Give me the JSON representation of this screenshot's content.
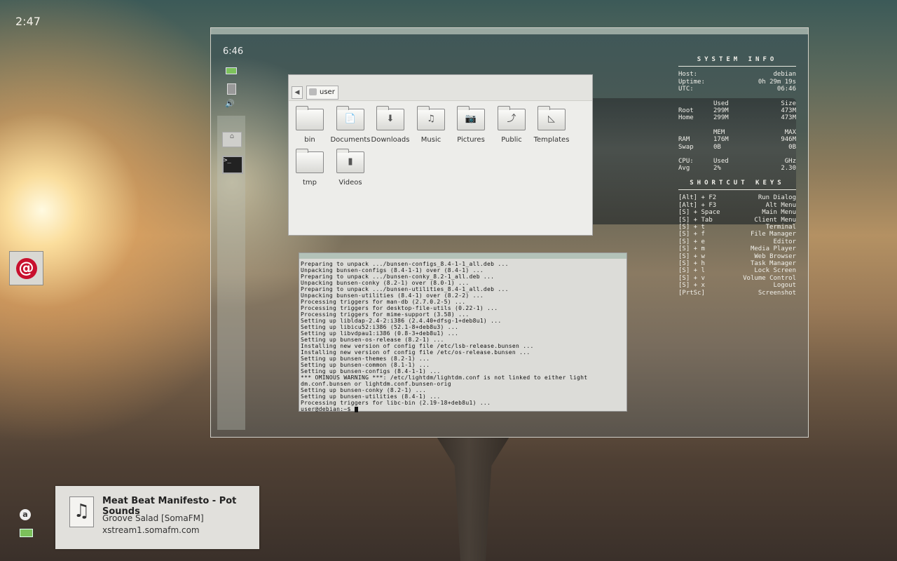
{
  "desktop": {
    "clock": "2:47",
    "launcher_icon": "debian-swirl-icon",
    "tray": {
      "icons": [
        "a-indicator-icon",
        "battery-icon"
      ],
      "a_label": "a"
    }
  },
  "notification": {
    "icon": "music-note-icon",
    "title": "Meat Beat Manifesto - Pot Sounds",
    "line1": "Groove Salad [SomaFM]",
    "line2": "xstream1.somafm.com"
  },
  "inner": {
    "clock": "6:46",
    "panel_icons": [
      "battery-icon",
      "clipboard-icon",
      "volume-icon",
      "home-folder-icon",
      "terminal-icon"
    ],
    "file_manager": {
      "path": "user",
      "items": [
        {
          "label": "bin",
          "glyph": ""
        },
        {
          "label": "Documents",
          "glyph": "📄"
        },
        {
          "label": "Downloads",
          "glyph": "⬇"
        },
        {
          "label": "Music",
          "glyph": "♫"
        },
        {
          "label": "Pictures",
          "glyph": "📷"
        },
        {
          "label": "Public",
          "glyph": "⤴"
        },
        {
          "label": "Templates",
          "glyph": "◺"
        },
        {
          "label": "tmp",
          "glyph": ""
        },
        {
          "label": "Videos",
          "glyph": "▮"
        }
      ]
    },
    "terminal": {
      "lines": [
        "Preparing to unpack .../bunsen-configs_8.4-1-1_all.deb ...",
        "Unpacking bunsen-configs (8.4-1-1) over (8.4-1) ...",
        "Preparing to unpack .../bunsen-conky_8.2-1_all.deb ...",
        "Unpacking bunsen-conky (8.2-1) over (8.0-1) ...",
        "Preparing to unpack .../bunsen-utilities_8.4-1_all.deb ...",
        "Unpacking bunsen-utilities (8.4-1) over (8.2-2) ...",
        "Processing triggers for man-db (2.7.0.2-5) ...",
        "Processing triggers for desktop-file-utils (0.22-1) ...",
        "Processing triggers for mime-support (3.58) ...",
        "Setting up libldap-2.4-2:i386 (2.4.40+dfsg-1+deb8u1) ...",
        "Setting up libicu52:i386 (52.1-8+deb8u3) ...",
        "Setting up libvdpau1:i386 (0.8-3+deb8u1) ...",
        "Setting up bunsen-os-release (8.2-1) ...",
        "Installing new version of config file /etc/lsb-release.bunsen ...",
        "Installing new version of config file /etc/os-release.bunsen ...",
        "Setting up bunsen-themes (8.2-1) ...",
        "Setting up bunsen-common (8.1-1) ...",
        "Setting up bunsen-configs (8.4-1-1) ...",
        "*** OMINOUS WARNING ***: /etc/lightdm/lightdm.conf is not linked to either light",
        "dm.conf.bunsen or lightdm.conf.bunsen-orig",
        "Setting up bunsen-conky (8.2-1) ...",
        "Setting up bunsen-utilities (8.4-1) ...",
        "Processing triggers for libc-bin (2.19-18+deb8u1) ..."
      ],
      "prompt": "user@debian:~$ "
    },
    "conky": {
      "system_header": "SYSTEM INFO",
      "host_label": "Host:",
      "host": "debian",
      "uptime_label": "Uptime:",
      "uptime": "0h 29m 19s",
      "utc_label": "UTC:",
      "utc": "06:46",
      "disk_header": [
        "",
        "Used",
        "Size"
      ],
      "disk_rows": [
        [
          "Root",
          "299M",
          "473M"
        ],
        [
          "Home",
          "299M",
          "473M"
        ]
      ],
      "mem_header": [
        "",
        "MEM",
        "MAX"
      ],
      "mem_rows": [
        [
          "RAM",
          "176M",
          "946M"
        ],
        [
          "Swap",
          "0B",
          "0B"
        ]
      ],
      "cpu_header": [
        "CPU:",
        "Used",
        "GHz"
      ],
      "cpu_rows": [
        [
          "Avg",
          "2%",
          "2.30"
        ]
      ],
      "shortcut_header": "SHORTCUT KEYS",
      "shortcuts": [
        [
          "[Alt] + F2",
          "Run Dialog"
        ],
        [
          "[Alt] + F3",
          "Alt Menu"
        ],
        [
          "[S] + Space",
          "Main Menu"
        ],
        [
          "[S] + Tab",
          "Client Menu"
        ],
        [
          "[S] + t",
          "Terminal"
        ],
        [
          "[S] + f",
          "File Manager"
        ],
        [
          "[S] + e",
          "Editor"
        ],
        [
          "[S] + m",
          "Media Player"
        ],
        [
          "[S] + w",
          "Web Browser"
        ],
        [
          "[S] + h",
          "Task Manager"
        ],
        [
          "[S] + l",
          "Lock Screen"
        ],
        [
          "[S] + v",
          "Volume Control"
        ],
        [
          "[S] + x",
          "Logout"
        ],
        [
          "[PrtSc]",
          "Screenshot"
        ]
      ]
    }
  }
}
